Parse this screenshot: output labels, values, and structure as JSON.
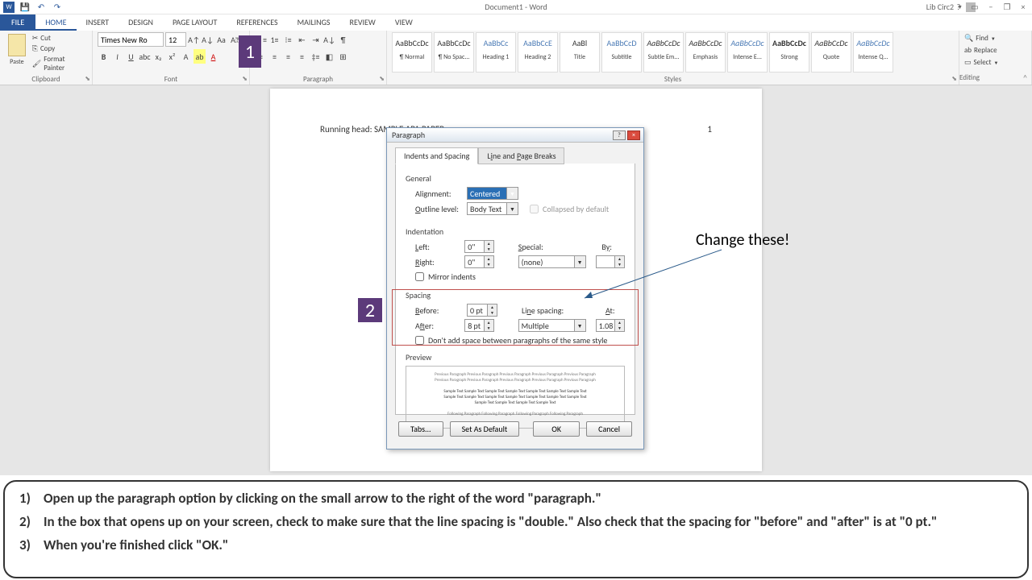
{
  "titlebar": {
    "doc_title": "Document1 - Word",
    "user": "Lib Circ2",
    "help": "?",
    "min": "−",
    "restore": "❐",
    "close": "×"
  },
  "tabs": {
    "file": "FILE",
    "home": "HOME",
    "insert": "INSERT",
    "design": "DESIGN",
    "page_layout": "PAGE LAYOUT",
    "references": "REFERENCES",
    "mailings": "MAILINGS",
    "review": "REVIEW",
    "view": "VIEW"
  },
  "ribbon": {
    "clipboard": {
      "label": "Clipboard",
      "paste": "Paste",
      "cut": "Cut",
      "copy": "Copy",
      "format_painter": "Format Painter"
    },
    "font": {
      "label": "Font",
      "name": "Times New Ro",
      "size": "12"
    },
    "paragraph": {
      "label": "Paragraph"
    },
    "styles": {
      "label": "Styles",
      "items": [
        {
          "preview": "AaBbCcDc",
          "name": "¶ Normal",
          "cls": ""
        },
        {
          "preview": "AaBbCcDc",
          "name": "¶ No Spac...",
          "cls": ""
        },
        {
          "preview": "AaBbCc",
          "name": "Heading 1",
          "cls": "accent"
        },
        {
          "preview": "AaBbCcE",
          "name": "Heading 2",
          "cls": "accent"
        },
        {
          "preview": "AaBl",
          "name": "Title",
          "cls": ""
        },
        {
          "preview": "AaBbCcD",
          "name": "Subtitle",
          "cls": "accent"
        },
        {
          "preview": "AaBbCcDc",
          "name": "Subtle Em...",
          "cls": "italic"
        },
        {
          "preview": "AaBbCcDc",
          "name": "Emphasis",
          "cls": "italic"
        },
        {
          "preview": "AaBbCcDc",
          "name": "Intense E...",
          "cls": "accent italic"
        },
        {
          "preview": "AaBbCcDc",
          "name": "Strong",
          "cls": "bold"
        },
        {
          "preview": "AaBbCcDc",
          "name": "Quote",
          "cls": "italic"
        },
        {
          "preview": "AaBbCcDc",
          "name": "Intense Q...",
          "cls": "accent italic"
        }
      ]
    },
    "editing": {
      "label": "Editing",
      "find": "Find",
      "replace": "Replace",
      "select": "Select"
    }
  },
  "page": {
    "running_head": "Running head: SAMPLE APA PAPER",
    "page_num": "1"
  },
  "markers": {
    "one": "1",
    "two": "2"
  },
  "dialog": {
    "title": "Paragraph",
    "tab1": "Indents and Spacing",
    "tab2": "Line and Page Breaks",
    "general": "General",
    "alignment_lbl": "Alignment:",
    "alignment_val": "Centered",
    "outline_lbl": "Outline level:",
    "outline_val": "Body Text",
    "collapsed": "Collapsed by default",
    "indentation": "Indentation",
    "left_lbl": "Left:",
    "left_val": "0\"",
    "right_lbl": "Right:",
    "right_val": "0\"",
    "special_lbl": "Special:",
    "special_val": "(none)",
    "by_lbl": "By:",
    "mirror": "Mirror indents",
    "spacing": "Spacing",
    "before_lbl": "Before:",
    "before_val": "0 pt",
    "after_lbl": "After:",
    "after_val": "8 pt",
    "line_spacing_lbl": "Line spacing:",
    "line_spacing_val": "Multiple",
    "at_lbl": "At:",
    "at_val": "1.08",
    "dont_add": "Don't add space between paragraphs of the same style",
    "preview": "Preview",
    "tabs_btn": "Tabs...",
    "default_btn": "Set As Default",
    "ok_btn": "OK",
    "cancel_btn": "Cancel"
  },
  "annotation": {
    "change": "Change these!"
  },
  "instructions": {
    "i1": "Open up the paragraph option by clicking on the small arrow to the right of the word \"paragraph.\"",
    "i2": "In the box that opens up on your screen, check to make sure that the line spacing is \"double.\"  Also check that the spacing for \"before\" and \"after\" is at \"0 pt.\"",
    "i3": "When you're finished click \"OK.\""
  }
}
